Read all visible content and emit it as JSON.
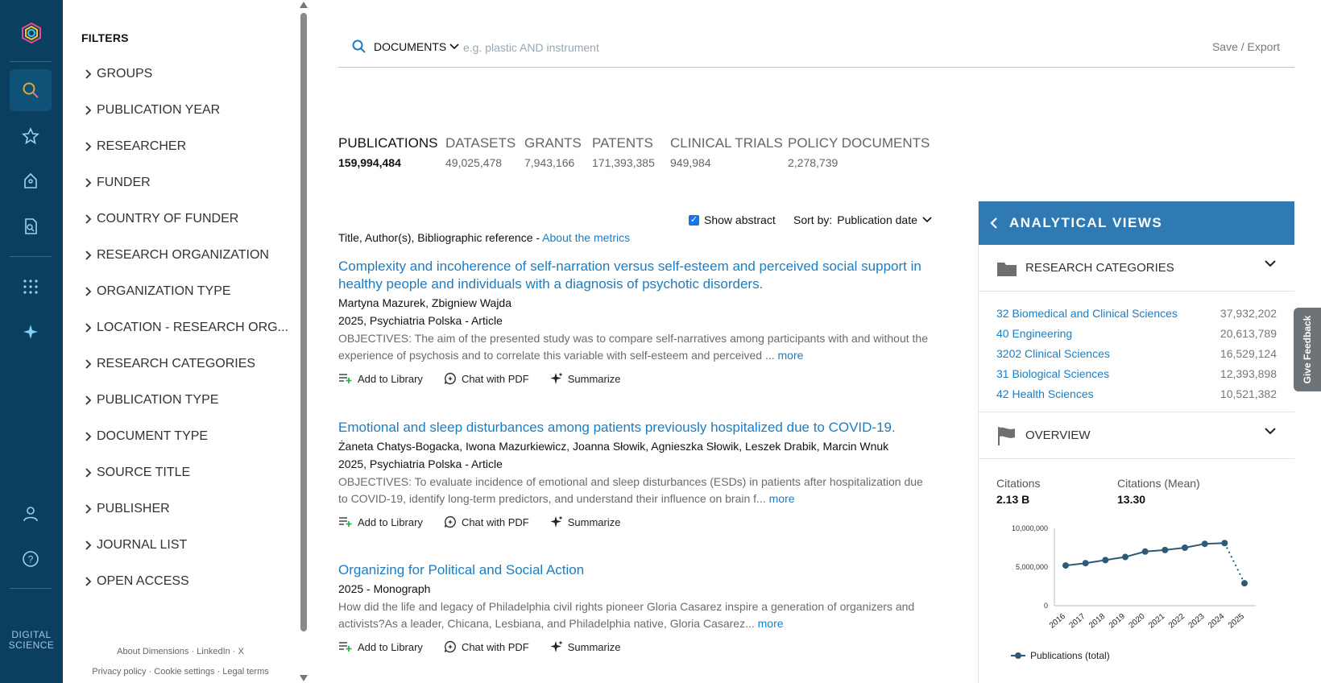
{
  "rail": {
    "brand_line1": "DIGITAL",
    "brand_line2": "SCIENCE"
  },
  "filters": {
    "heading": "FILTERS",
    "items": [
      "GROUPS",
      "PUBLICATION YEAR",
      "RESEARCHER",
      "FUNDER",
      "COUNTRY OF FUNDER",
      "RESEARCH ORGANIZATION",
      "ORGANIZATION TYPE",
      "LOCATION - RESEARCH ORG...",
      "RESEARCH CATEGORIES",
      "PUBLICATION TYPE",
      "DOCUMENT TYPE",
      "SOURCE TITLE",
      "PUBLISHER",
      "JOURNAL LIST",
      "OPEN ACCESS"
    ],
    "footer_line1": "About Dimensions · LinkedIn · X",
    "footer_line2": "Privacy policy · Cookie settings · Legal terms"
  },
  "search": {
    "scope": "DOCUMENTS",
    "placeholder": "e.g. plastic AND instrument",
    "save_export": "Save / Export"
  },
  "tabs": [
    {
      "label": "PUBLICATIONS",
      "count": "159,994,484"
    },
    {
      "label": "DATASETS",
      "count": "49,025,478"
    },
    {
      "label": "GRANTS",
      "count": "7,943,166"
    },
    {
      "label": "PATENTS",
      "count": "171,393,385"
    },
    {
      "label": "CLINICAL TRIALS",
      "count": "949,984"
    },
    {
      "label": "POLICY DOCUMENTS",
      "count": "2,278,739"
    }
  ],
  "results_header": {
    "show_abstract": "Show abstract",
    "sort_label": "Sort by:",
    "sort_value": "Publication date",
    "ref_text": "Title, Author(s), Bibliographic reference - ",
    "ref_link": "About the metrics"
  },
  "actions": {
    "add": "Add to Library",
    "chat": "Chat with PDF",
    "summarize": "Summarize"
  },
  "results": [
    {
      "title": "Complexity and incoherence of self-narration versus self-esteem and perceived social support in healthy people and individuals with a diagnosis of psychotic disorders.",
      "authors": "Martyna Mazurek, Zbigniew Wajda",
      "meta": "2025, Psychiatria Polska - Article",
      "abstract": "OBJECTIVES: The aim of the presented study was to compare self-narratives among participants with and without the experience of psychosis and to correlate this variable with self-esteem and perceived ...",
      "more": "more"
    },
    {
      "title": "Emotional and sleep disturbances among patients previously hospitalized due to COVID-19.",
      "authors": "Żaneta Chatys-Bogacka, Iwona Mazurkiewicz, Joanna Słowik, Agnieszka Słowik, Leszek Drabik, Marcin Wnuk",
      "meta": "2025, Psychiatria Polska - Article",
      "abstract": "OBJECTIVES: To evaluate incidence of emotional and sleep disturbances (ESDs) in patients after hospitalization due to COVID-19, identify long-term predictors, and understand their influence on brain f...",
      "more": "more"
    },
    {
      "title": "Organizing for Political and Social Action",
      "meta": "2025 - Monograph",
      "abstract": "How did the life and legacy of Philadelphia civil rights pioneer Gloria Casarez inspire a generation of organizers and activists?As a leader, Chicana, Lesbiana, and Philadelphia native, Gloria Casarez...",
      "more": "more"
    }
  ],
  "analytical": {
    "title": "ANALYTICAL VIEWS",
    "research_categories": "RESEARCH CATEGORIES",
    "categories": [
      {
        "name": "32 Biomedical and Clinical Sciences",
        "value": "37,932,202"
      },
      {
        "name": "40 Engineering",
        "value": "20,613,789"
      },
      {
        "name": "3202 Clinical Sciences",
        "value": "16,529,124"
      },
      {
        "name": "31 Biological Sciences",
        "value": "12,393,898"
      },
      {
        "name": "42 Health Sciences",
        "value": "10,521,382"
      }
    ],
    "overview": "OVERVIEW",
    "citations_label": "Citations",
    "citations_value": "2.13 B",
    "citations_mean_label": "Citations (Mean)",
    "citations_mean_value": "13.30"
  },
  "feedback": "Give Feedback",
  "colors": {
    "rail": "#0b3f5f",
    "accent": "#2f7ab3",
    "link": "#1b7dc4",
    "line": "#2e5a78"
  },
  "chart_data": {
    "type": "line",
    "x": [
      "2016",
      "2017",
      "2018",
      "2019",
      "2020",
      "2021",
      "2022",
      "2023",
      "2024",
      "2025"
    ],
    "series": [
      {
        "name": "Publications (total)",
        "values": [
          5200000,
          5500000,
          5900000,
          6300000,
          7000000,
          7200000,
          7500000,
          8000000,
          8100000,
          2900000
        ]
      }
    ],
    "yticks": [
      "10,000,000",
      "5,000,000",
      "0"
    ],
    "ylim": [
      0,
      10000000
    ],
    "last_segment": "dotted",
    "legend": "bottom-left",
    "title": "",
    "xlabel": "",
    "ylabel": ""
  }
}
